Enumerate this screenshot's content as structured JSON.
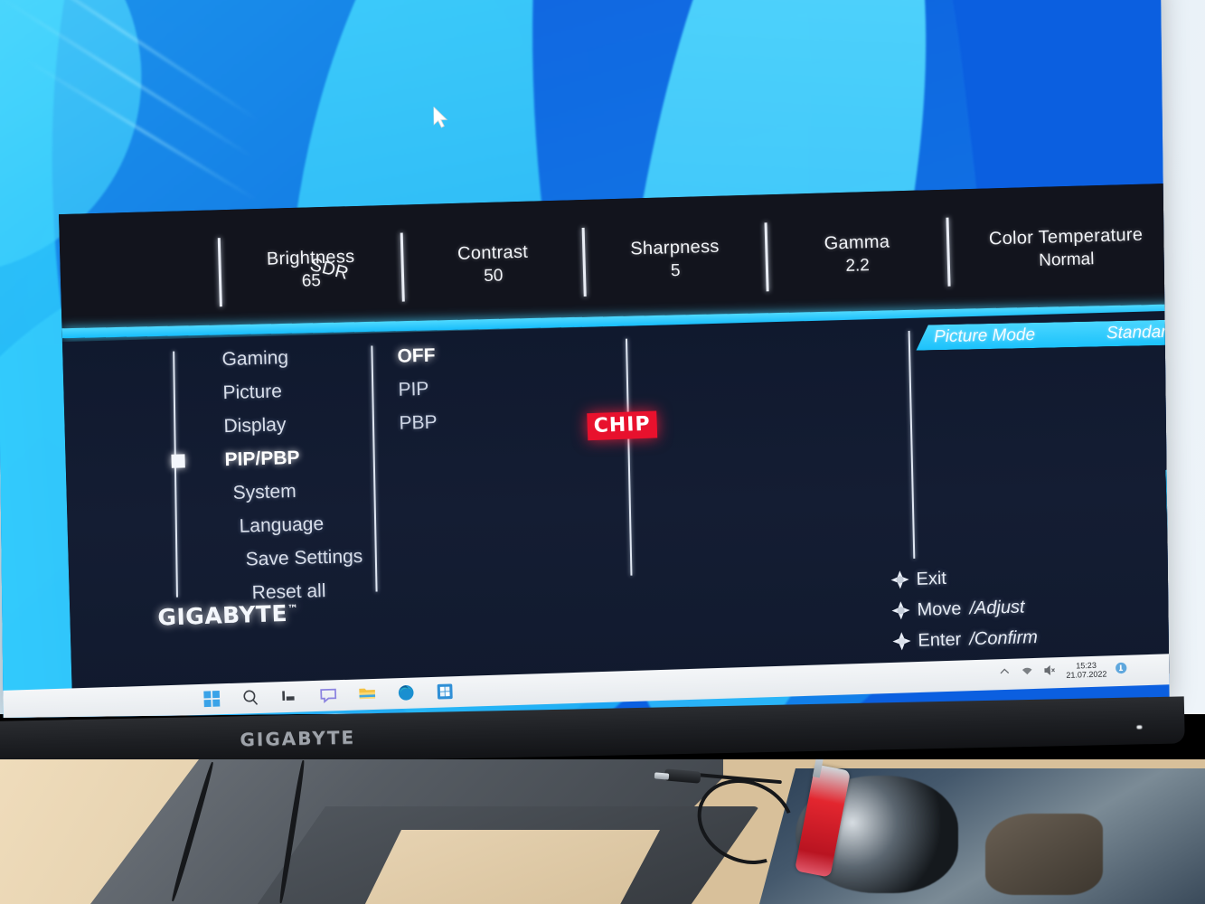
{
  "scene": {
    "device": "GIGABYTE curved gaming monitor",
    "bezel_brand": "GIGABYTE",
    "desktop_cursor_icon": "mouse-pointer-icon"
  },
  "osd": {
    "brand": "GIGABYTE",
    "brand_sup": "™",
    "watermark": "CHIP",
    "status_bar": [
      {
        "label": "SDR",
        "value": ""
      },
      {
        "label": "Brightness",
        "value": "65"
      },
      {
        "label": "Contrast",
        "value": "50"
      },
      {
        "label": "Sharpness",
        "value": "5"
      },
      {
        "label": "Gamma",
        "value": "2.2"
      },
      {
        "label": "Color Temperature",
        "value": "Normal"
      }
    ],
    "ribbon": {
      "label": "Picture Mode",
      "value": "Standard"
    },
    "menu": {
      "items": [
        {
          "label": "Gaming",
          "selected": false
        },
        {
          "label": "Picture",
          "selected": false
        },
        {
          "label": "Display",
          "selected": false
        },
        {
          "label": "PIP/PBP",
          "selected": true
        },
        {
          "label": "System",
          "selected": false
        },
        {
          "label": "Language",
          "selected": false
        },
        {
          "label": "Save Settings",
          "selected": false
        },
        {
          "label": "Reset all",
          "selected": false
        }
      ]
    },
    "options": {
      "items": [
        {
          "label": "OFF",
          "selected": true
        },
        {
          "label": "PIP",
          "selected": false
        },
        {
          "label": "PBP",
          "selected": false
        }
      ]
    },
    "hints": [
      {
        "icon": "joystick-icon",
        "action": "Exit",
        "sub": ""
      },
      {
        "icon": "joystick-icon",
        "action": "Move",
        "sub": "/Adjust"
      },
      {
        "icon": "joystick-icon",
        "action": "Enter",
        "sub": "/Confirm"
      }
    ],
    "colors": {
      "accent_cyan": "#2ec8fb",
      "panel_navy": "#131d33",
      "top_bar": "#12141d",
      "watermark_red": "#e8112d"
    }
  },
  "taskbar": {
    "icons": [
      {
        "name": "start-icon"
      },
      {
        "name": "search-icon"
      },
      {
        "name": "task-view-icon"
      },
      {
        "name": "chat-icon"
      },
      {
        "name": "file-explorer-icon"
      },
      {
        "name": "edge-icon"
      },
      {
        "name": "microsoft-store-icon"
      }
    ],
    "tray": {
      "overflow_icon": "chevron-up-icon",
      "network_icon": "wifi-icon",
      "volume_icon": "volume-muted-icon",
      "time": "15:23",
      "date": "21.07.2022",
      "notification_icon": "notification-icon"
    }
  }
}
